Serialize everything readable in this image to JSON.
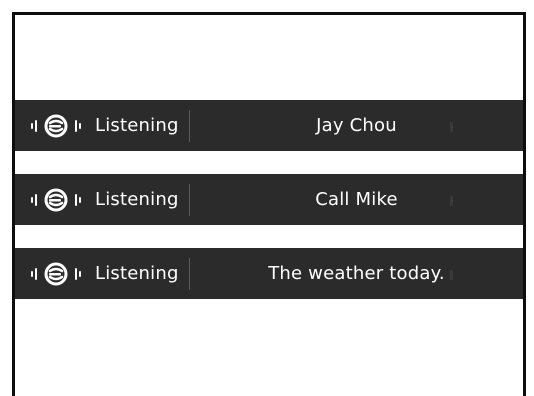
{
  "bars": [
    {
      "status": "Listening",
      "query": "Jay Chou",
      "icon": "voice-assistant-icon"
    },
    {
      "status": "Listening",
      "query": "Call Mike",
      "icon": "voice-assistant-icon"
    },
    {
      "status": "Listening",
      "query": "The weather today.",
      "icon": "voice-assistant-icon"
    }
  ],
  "colors": {
    "bar_background": "#2b2b2b",
    "text": "#ffffff",
    "frame_border": "#0d0d0d"
  }
}
